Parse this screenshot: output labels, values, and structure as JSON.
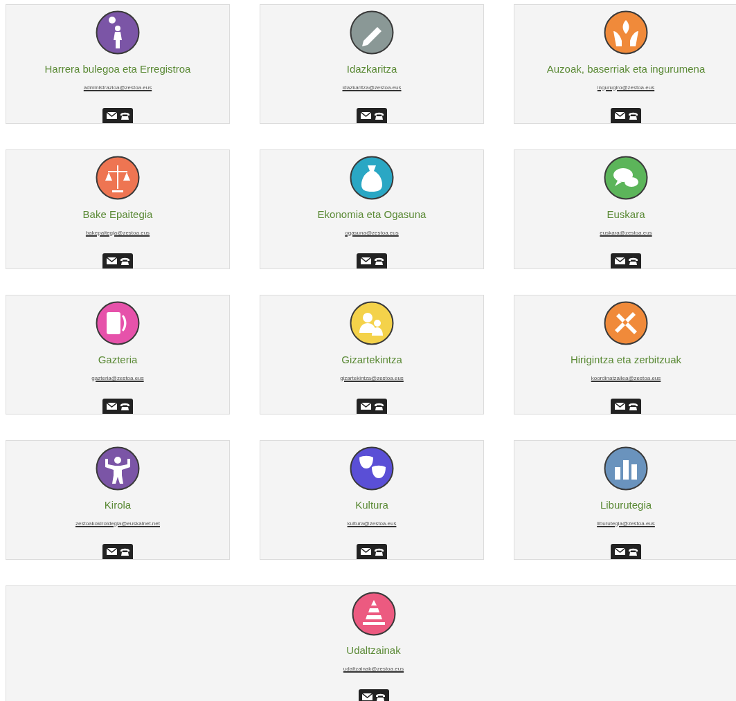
{
  "departments": [
    {
      "title": "Harrera bulegoa eta Erregistroa",
      "email": "administrazioa@zestoa.eus",
      "color": "#7b55a6"
    },
    {
      "title": "Idazkaritza",
      "email": "idazkaritza@zestoa.eus",
      "color": "#8a9896"
    },
    {
      "title": "Auzoak, baserriak eta ingurumena",
      "email": "ingurugiro@zestoa.eus",
      "color": "#f08a3a"
    },
    {
      "title": "Bake Epaitegia",
      "email": "bakepaitegia@zestoa.eus",
      "color": "#ee7552"
    },
    {
      "title": "Ekonomia eta Ogasuna",
      "email": "ogasuna@zestoa.eus",
      "color": "#2aa7c4"
    },
    {
      "title": "Euskara",
      "email": "euskara@zestoa.eus",
      "color": "#5cb55a"
    },
    {
      "title": "Gazteria",
      "email": "gazteria@zestoa.eus",
      "color": "#e652aa"
    },
    {
      "title": "Gizartekintza",
      "email": "gizartekintza@zestoa.eus",
      "color": "#f4d24a"
    },
    {
      "title": "Hirigintza eta zerbitzuak",
      "email": "koordinatzailea@zestoa.eus",
      "color": "#f08a3a"
    },
    {
      "title": "Kirola",
      "email": "zestoakokiroldegia@euskalnet.net",
      "color": "#7b55a6"
    },
    {
      "title": "Kultura",
      "email": "kultura@zestoa.eus",
      "color": "#5a4fd6"
    },
    {
      "title": "Liburutegia",
      "email": "liburutegia@zestoa.eus",
      "color": "#6a93bd"
    },
    {
      "title": "Udaltzainak",
      "email": "udaltzainak@zestoa.eus",
      "color": "#ec5a80"
    }
  ]
}
